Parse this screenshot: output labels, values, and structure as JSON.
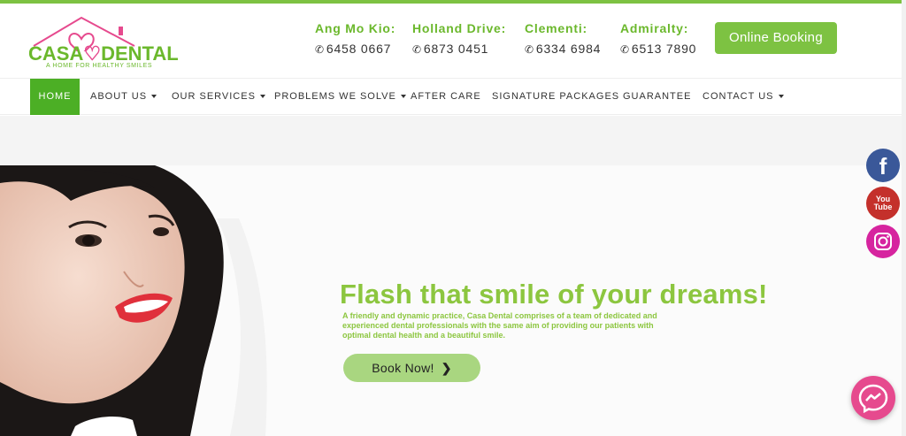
{
  "brand": {
    "name_left": "CASA",
    "name_right": "DENTAL",
    "tagline": "A HOME FOR HEALTHY SMILES",
    "primary_color": "#7dc242",
    "accent_color": "#e64a8e"
  },
  "locations": [
    {
      "name": "Ang Mo Kio:",
      "phone": "6458 0667"
    },
    {
      "name": "Holland Drive:",
      "phone": "6873 0451"
    },
    {
      "name": "Clementi:",
      "phone": "6334 6984"
    },
    {
      "name": "Admiralty:",
      "phone": "6513 7890"
    }
  ],
  "header": {
    "booking_label": "Online Booking"
  },
  "nav": {
    "items": [
      {
        "label": "HOME",
        "active": true,
        "dropdown": false
      },
      {
        "label": "ABOUT US",
        "active": false,
        "dropdown": true
      },
      {
        "label": "OUR SERVICES",
        "active": false,
        "dropdown": true
      },
      {
        "label": "PROBLEMS WE SOLVE",
        "active": false,
        "dropdown": true
      },
      {
        "label": "AFTER CARE",
        "active": false,
        "dropdown": false
      },
      {
        "label": "SIGNATURE PACKAGES",
        "active": false,
        "dropdown": false
      },
      {
        "label": "GUARANTEE",
        "active": false,
        "dropdown": false
      },
      {
        "label": "CONTACT US",
        "active": false,
        "dropdown": true
      }
    ]
  },
  "hero": {
    "title": "Flash that smile of your dreams!",
    "description": "A friendly and dynamic practice, Casa Dental comprises of a team of dedicated and experienced dental professionals with the same aim of providing our patients with optimal dental health and a beautiful smile.",
    "cta_label": "Book Now!"
  },
  "social": {
    "facebook_glyph": "f",
    "youtube_top": "You",
    "youtube_bottom": "Tube",
    "icons": [
      "facebook-icon",
      "youtube-icon",
      "instagram-icon",
      "messenger-icon"
    ]
  }
}
